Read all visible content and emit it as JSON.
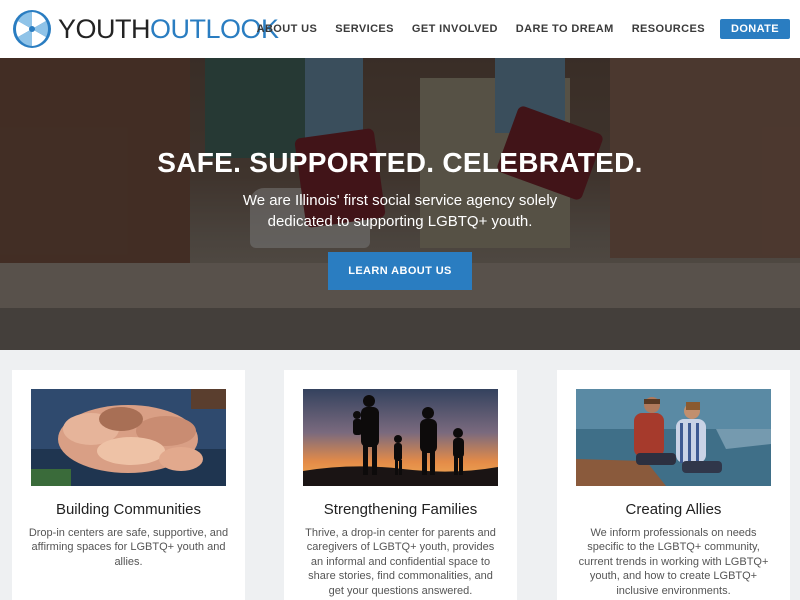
{
  "brand": {
    "word1": "YOUTH",
    "word2": "OUTLOOK",
    "accent": "#2a7dc1"
  },
  "nav": {
    "items": [
      {
        "label": "ABOUT US"
      },
      {
        "label": "SERVICES"
      },
      {
        "label": "GET INVOLVED"
      },
      {
        "label": "DARE TO DREAM"
      },
      {
        "label": "RESOURCES"
      }
    ],
    "donate_label": "DONATE"
  },
  "hero": {
    "title": "SAFE. SUPPORTED. CELEBRATED.",
    "subtitle_line1": "We are Illinois' first social service agency solely",
    "subtitle_line2": "dedicated to supporting LGBTQ+ youth.",
    "button_label": "LEARN ABOUT US"
  },
  "cards": [
    {
      "title": "Building Communities",
      "text": "Drop-in centers are safe, supportive, and affirming spaces for LGBTQ+ youth and allies."
    },
    {
      "title": "Strengthening Families",
      "text": "Thrive, a drop-in center for parents and caregivers of LGBTQ+ youth, provides an informal and confidential space to share stories, find commonalities, and get your questions answered."
    },
    {
      "title": "Creating Allies",
      "text": "We inform professionals on needs specific to the LGBTQ+ community, current trends in working with LGBTQ+ youth, and how to create LGBTQ+ inclusive environments."
    }
  ]
}
